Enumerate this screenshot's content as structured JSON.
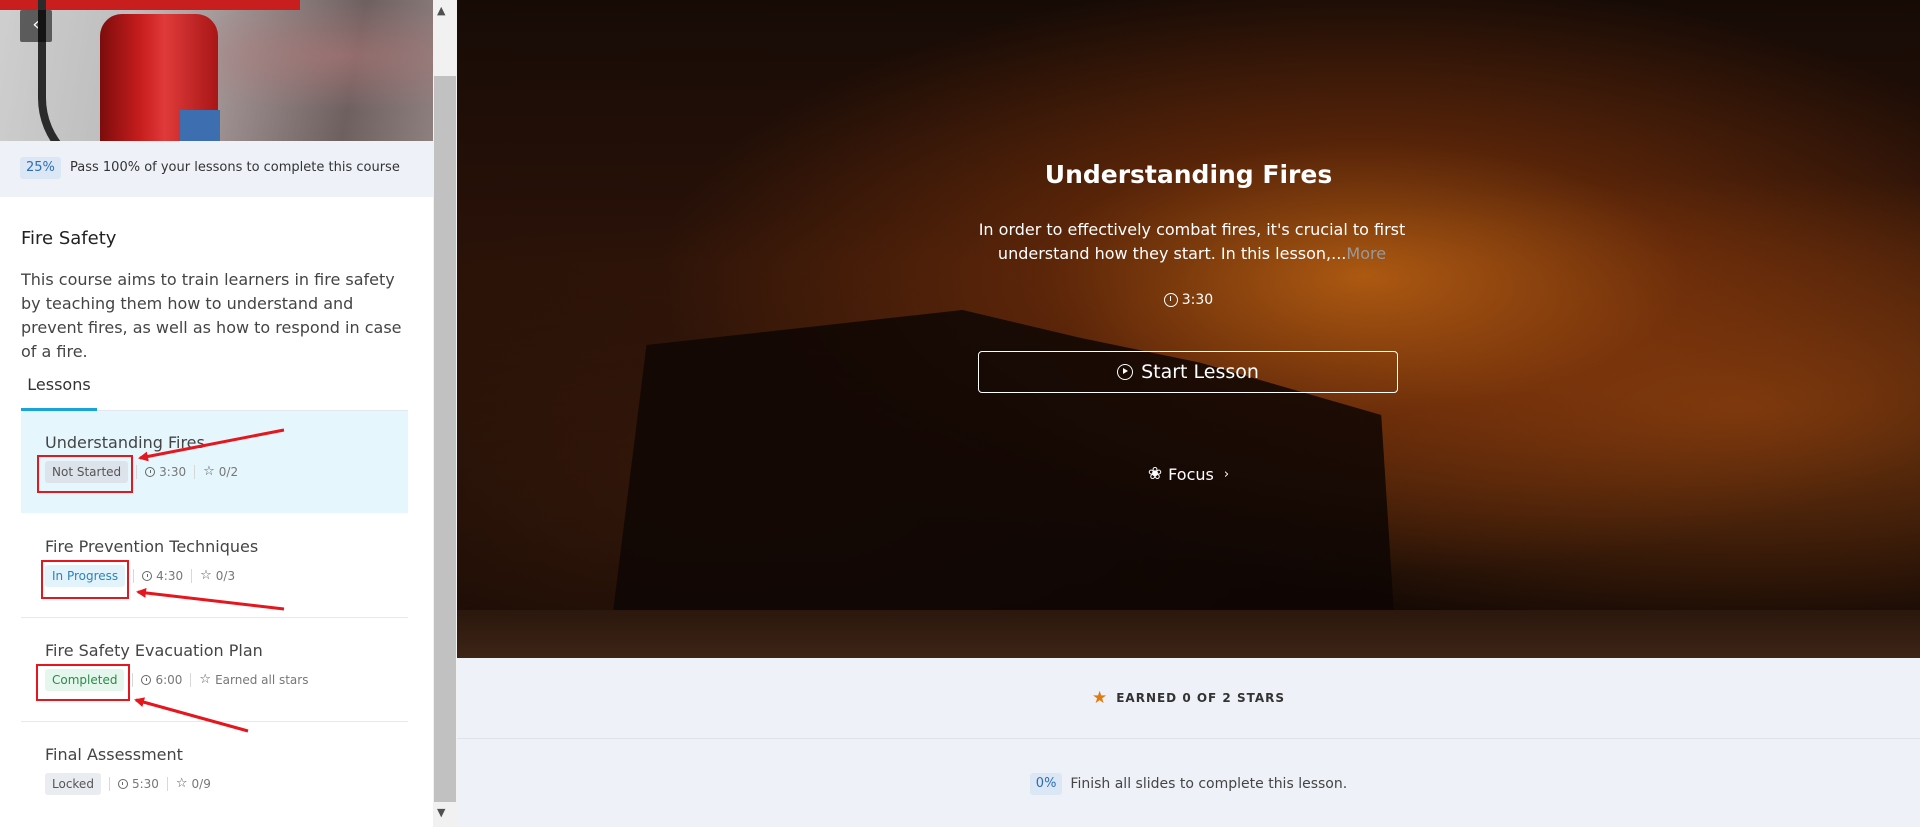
{
  "course": {
    "progress_percent": "25%",
    "progress_text": "Pass 100% of your lessons to complete this course",
    "title": "Fire Safety",
    "description": "This course aims to train learners in fire safety by teaching them how to understand and prevent fires, as well as how to respond in case of a fire."
  },
  "tabs": {
    "lessons": "Lessons"
  },
  "lessons": [
    {
      "title": "Understanding Fires",
      "status": "Not Started",
      "duration": "3:30",
      "stars": "0/2"
    },
    {
      "title": "Fire Prevention Techniques",
      "status": "In Progress",
      "duration": "4:30",
      "stars": "0/3"
    },
    {
      "title": "Fire Safety Evacuation Plan",
      "status": "Completed",
      "duration": "6:00",
      "stars": "Earned all stars"
    },
    {
      "title": "Final Assessment",
      "status": "Locked",
      "duration": "5:30",
      "stars": "0/9"
    }
  ],
  "hero": {
    "title": "Understanding Fires",
    "description": "In order to effectively combat fires, it's crucial to first understand how they start. In this lesson,...",
    "more": "More",
    "duration": "3:30",
    "start_button": "Start Lesson",
    "focus": "Focus"
  },
  "stars_summary": "EARNED 0 OF 2 STARS",
  "lesson_progress": {
    "percent": "0%",
    "text": "Finish all slides to complete this lesson."
  },
  "icons": {
    "back": "chevron-left-icon",
    "clock": "clock-icon",
    "star": "star-icon",
    "play": "play-circle-icon",
    "focus": "lotus-icon",
    "chevron": "chevron-right-icon"
  },
  "colors": {
    "accent": "#1aa3d6",
    "annotation": "#e5161d",
    "star": "#e07b12"
  }
}
